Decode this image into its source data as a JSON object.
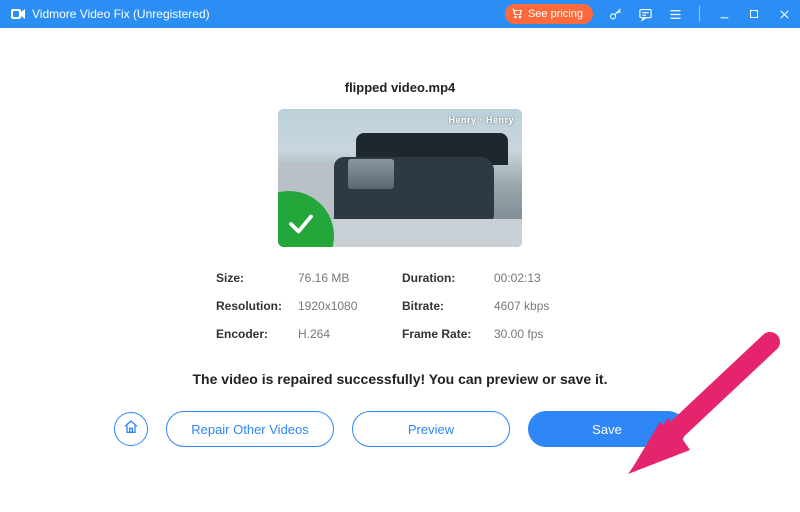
{
  "titlebar": {
    "app_name": "Vidmore Video Fix (Unregistered)",
    "pricing_label": "See pricing"
  },
  "file": {
    "name": "flipped video.mp4",
    "thumb_brand": "Henry · Henry"
  },
  "info": {
    "size_label": "Size:",
    "size_value": "76.16 MB",
    "duration_label": "Duration:",
    "duration_value": "00:02:13",
    "resolution_label": "Resolution:",
    "resolution_value": "1920x1080",
    "bitrate_label": "Bitrate:",
    "bitrate_value": "4607 kbps",
    "encoder_label": "Encoder:",
    "encoder_value": "H.264",
    "framerate_label": "Frame Rate:",
    "framerate_value": "30.00 fps"
  },
  "status": {
    "success_msg": "The video is repaired successfully! You can preview or save it."
  },
  "buttons": {
    "repair_other": "Repair Other Videos",
    "preview": "Preview",
    "save": "Save"
  },
  "colors": {
    "accent": "#2f86f6",
    "titlebar": "#2a8ef4",
    "pricing": "#ff6a3d",
    "success_badge": "#23a63a",
    "annotation_arrow": "#e6246e"
  }
}
